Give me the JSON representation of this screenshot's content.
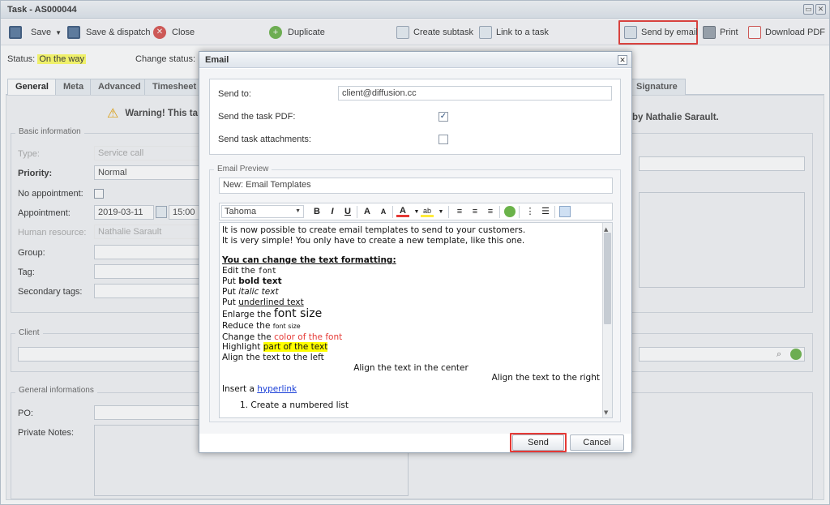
{
  "window": {
    "title": "Task - AS000044"
  },
  "toolbar": {
    "save": "Save",
    "save_dispatch": "Save & dispatch",
    "close": "Close",
    "duplicate": "Duplicate",
    "create_subtask": "Create subtask",
    "link_task": "Link to a task",
    "send_email": "Send by email",
    "print": "Print",
    "download_pdf": "Download PDF"
  },
  "status": {
    "label": "Status:",
    "value": "On the way",
    "change_label": "Change status:"
  },
  "tabs": [
    "General",
    "Meta",
    "Advanced",
    "Timesheet",
    "Signature"
  ],
  "warning": {
    "left": "Warning! This ta",
    "right": "by Nathalie Sarault."
  },
  "basic": {
    "legend": "Basic information",
    "type_label": "Type:",
    "type_value": "Service call",
    "priority_label": "Priority:",
    "priority_value": "Normal",
    "noappt_label": "No appointment:",
    "appt_label": "Appointment:",
    "appt_date": "2019-03-11",
    "appt_time": "15:00",
    "hr_label": "Human resource:",
    "hr_value": "Nathalie Sarault",
    "group_label": "Group:",
    "tag_label": "Tag:",
    "sectags_label": "Secondary tags:"
  },
  "client": {
    "legend": "Client"
  },
  "geninfo": {
    "legend": "General informations",
    "po_label": "PO:",
    "notes_label": "Private Notes:"
  },
  "modal": {
    "title": "Email",
    "send_to_label": "Send to:",
    "send_to_value": "client@diffusion.cc",
    "pdf_label": "Send the task PDF:",
    "attach_label": "Send task attachments:",
    "preview_legend": "Email Preview",
    "subject": "New: Email Templates",
    "font_select": "Tahoma",
    "send": "Send",
    "cancel": "Cancel"
  },
  "editor": {
    "l1": "It is now possible to create email templates to send to your customers.",
    "l2": "It is very simple! You only have to create a new template, like this one.",
    "heading": "You can change the text formatting:",
    "edit_pre": "Edit the ",
    "edit_code": "font",
    "bold_pre": "Put ",
    "bold_txt": "bold text",
    "italic_pre": "Put ",
    "italic_txt": "italic text",
    "under_pre": "Put ",
    "under_txt": "underlined text",
    "enl_pre": "Enlarge the ",
    "enl_txt": "font size",
    "red_pre": "Reduce the ",
    "red_txt": "font size",
    "col_pre": "Change the ",
    "col_txt": "color of the font",
    "hl_pre": "Highlight ",
    "hl_txt": "part of the text",
    "left": "Align the text to the left",
    "center": "Align the text in the center",
    "right": "Align the text to the right",
    "link_pre": "Insert a ",
    "link_txt": "hyperlink",
    "numlist": "Create a numbered list"
  }
}
